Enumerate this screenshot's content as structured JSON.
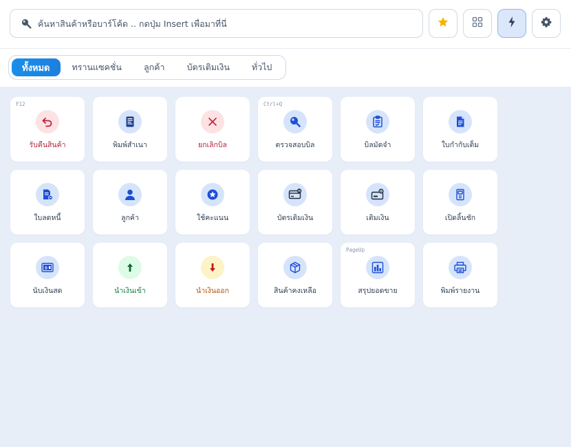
{
  "search": {
    "placeholder": "ค้นหาสินค้าหรือบาร์โค้ด .. กดปุ่ม Insert เพื่อมาที่นี่",
    "value": ""
  },
  "toolbar": {
    "star_icon": "star-icon",
    "grid_icon": "grid-icon",
    "bolt_icon": "bolt-icon",
    "gear_icon": "gear-icon"
  },
  "tabs": [
    {
      "label": "ทั้งหมด",
      "active": true
    },
    {
      "label": "ทรานแซคชั่น",
      "active": false
    },
    {
      "label": "ลูกค้า",
      "active": false
    },
    {
      "label": "บัตรเติมเงิน",
      "active": false
    },
    {
      "label": "ทั่วไป",
      "active": false
    }
  ],
  "tiles": [
    {
      "label": "รับคืนสินค้า",
      "hotkey": "F12",
      "icon": "return-icon",
      "color": "#b4233a",
      "bg": "red"
    },
    {
      "label": "พิมพ์สำเนา",
      "hotkey": "",
      "icon": "receipt-icon",
      "color": "#334155",
      "bg": "blue"
    },
    {
      "label": "ยกเลิกบิล",
      "hotkey": "",
      "icon": "close-icon",
      "color": "#b4233a",
      "bg": "red"
    },
    {
      "label": "ตรวจสอบบิล",
      "hotkey": "Ctrl+Q",
      "icon": "search-bill-icon",
      "color": "#334155",
      "bg": "blue"
    },
    {
      "label": "บิลมัดจำ",
      "hotkey": "",
      "icon": "clipboard-icon",
      "color": "#334155",
      "bg": "blue"
    },
    {
      "label": "ใบกำกับเต็ม",
      "hotkey": "",
      "icon": "document-icon",
      "color": "#334155",
      "bg": "blue"
    },
    {
      "label": "ใบลดหนี้",
      "hotkey": "",
      "icon": "credit-note-icon",
      "color": "#334155",
      "bg": "blue"
    },
    {
      "label": "ลูกค้า",
      "hotkey": "",
      "icon": "user-icon",
      "color": "#334155",
      "bg": "blue"
    },
    {
      "label": "ใช้คะแนน",
      "hotkey": "",
      "icon": "points-icon",
      "color": "#334155",
      "bg": "blue"
    },
    {
      "label": "บัตรเติมเงิน",
      "hotkey": "",
      "icon": "card-icon",
      "color": "#334155",
      "bg": "blue"
    },
    {
      "label": "เติมเงิน",
      "hotkey": "",
      "icon": "wallet-icon",
      "color": "#334155",
      "bg": "blue"
    },
    {
      "label": "เปิดลิ้นชัก",
      "hotkey": "",
      "icon": "drawer-icon",
      "color": "#334155",
      "bg": "blue"
    },
    {
      "label": "นับเงินสด",
      "hotkey": "",
      "icon": "cash-count-icon",
      "color": "#334155",
      "bg": "blue"
    },
    {
      "label": "นำเงินเข้า",
      "hotkey": "",
      "icon": "arrow-up-icon",
      "color": "#15803d",
      "bg": "green"
    },
    {
      "label": "นำเงินออก",
      "hotkey": "",
      "icon": "arrow-down-icon",
      "color": "#b45309",
      "bg": "yellow"
    },
    {
      "label": "สินค้าคงเหลือ",
      "hotkey": "",
      "icon": "box-icon",
      "color": "#334155",
      "bg": "blue"
    },
    {
      "label": "สรุปยอดขาย",
      "hotkey": "PageUp",
      "icon": "chart-icon",
      "color": "#334155",
      "bg": "blue"
    },
    {
      "label": "พิมพ์รายงาน",
      "hotkey": "",
      "icon": "printer-icon",
      "color": "#334155",
      "bg": "blue"
    }
  ]
}
